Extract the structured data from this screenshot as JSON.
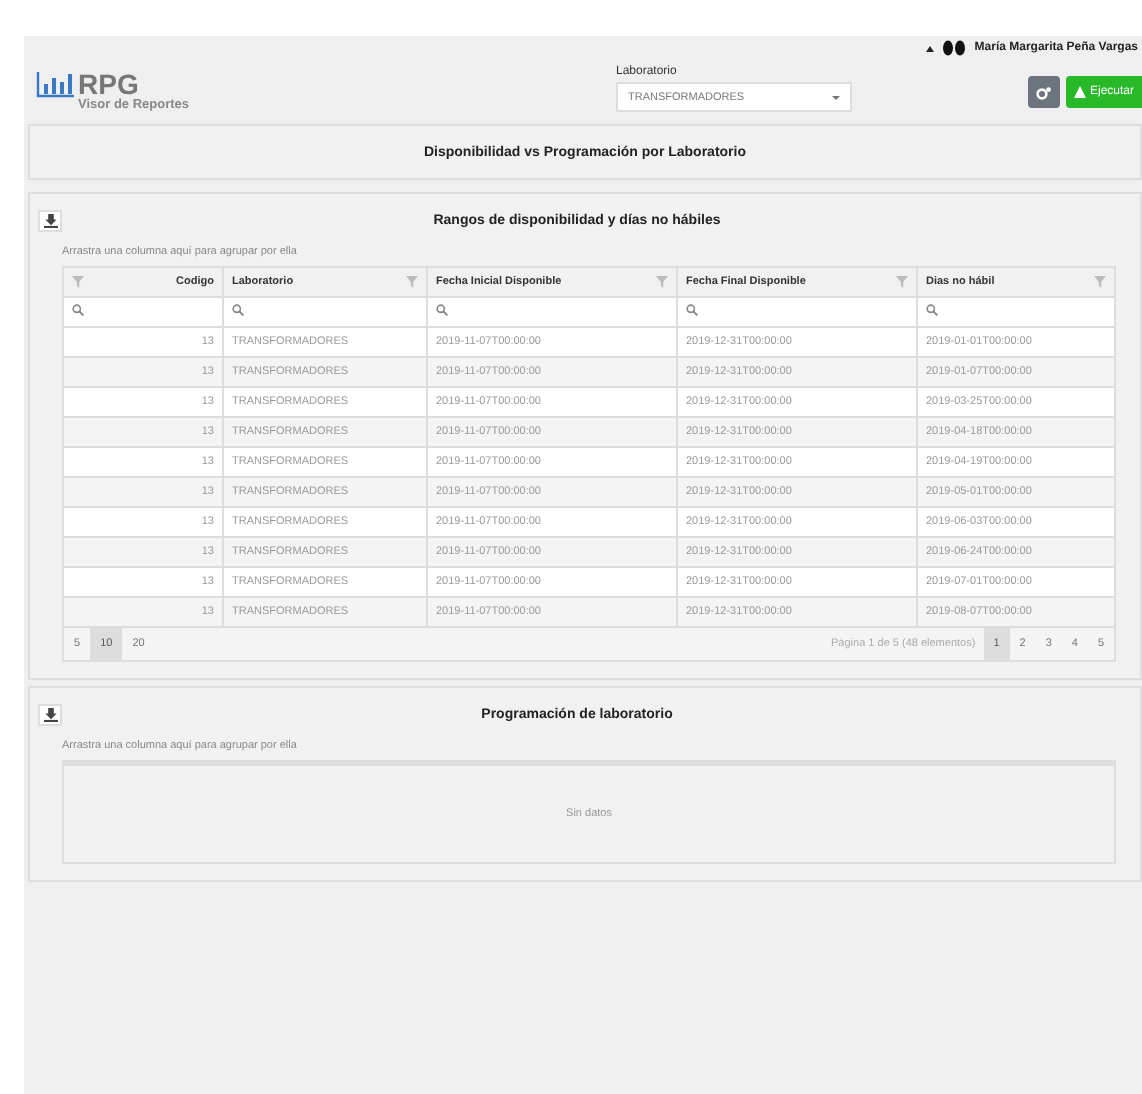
{
  "user": {
    "name": "María Margarita Peña Vargas"
  },
  "logo": {
    "title": "RPG",
    "subtitle": "Visor de Reportes"
  },
  "filter": {
    "label": "Laboratorio",
    "value": "TRANSFORMADORES"
  },
  "toolbar": {
    "run_label": "Ejecutar"
  },
  "report_title": "Disponibilidad vs Programación por Laboratorio",
  "grid1": {
    "title": "Rangos de disponibilidad y días no hábiles",
    "group_hint": "Arrastra una columna aquí para agrupar por ella",
    "columns": [
      "Codigo",
      "Laboratorio",
      "Fecha Inicial Disponible",
      "Fecha Final Disponible",
      "Dias no hábil"
    ],
    "rows": [
      [
        "13",
        "TRANSFORMADORES",
        "2019-11-07T00:00:00",
        "2019-12-31T00:00:00",
        "2019-01-01T00:00:00"
      ],
      [
        "13",
        "TRANSFORMADORES",
        "2019-11-07T00:00:00",
        "2019-12-31T00:00:00",
        "2019-01-07T00:00:00"
      ],
      [
        "13",
        "TRANSFORMADORES",
        "2019-11-07T00:00:00",
        "2019-12-31T00:00:00",
        "2019-03-25T00:00:00"
      ],
      [
        "13",
        "TRANSFORMADORES",
        "2019-11-07T00:00:00",
        "2019-12-31T00:00:00",
        "2019-04-18T00:00:00"
      ],
      [
        "13",
        "TRANSFORMADORES",
        "2019-11-07T00:00:00",
        "2019-12-31T00:00:00",
        "2019-04-19T00:00:00"
      ],
      [
        "13",
        "TRANSFORMADORES",
        "2019-11-07T00:00:00",
        "2019-12-31T00:00:00",
        "2019-05-01T00:00:00"
      ],
      [
        "13",
        "TRANSFORMADORES",
        "2019-11-07T00:00:00",
        "2019-12-31T00:00:00",
        "2019-06-03T00:00:00"
      ],
      [
        "13",
        "TRANSFORMADORES",
        "2019-11-07T00:00:00",
        "2019-12-31T00:00:00",
        "2019-06-24T00:00:00"
      ],
      [
        "13",
        "TRANSFORMADORES",
        "2019-11-07T00:00:00",
        "2019-12-31T00:00:00",
        "2019-07-01T00:00:00"
      ],
      [
        "13",
        "TRANSFORMADORES",
        "2019-11-07T00:00:00",
        "2019-12-31T00:00:00",
        "2019-08-07T00:00:00"
      ]
    ],
    "page_sizes": [
      {
        "label": "5",
        "selected": false
      },
      {
        "label": "10",
        "selected": true
      },
      {
        "label": "20",
        "selected": false
      }
    ],
    "page_info": "Página 1 de 5 (48 elementos)",
    "pages": [
      {
        "label": "1",
        "selected": true
      },
      {
        "label": "2",
        "selected": false
      },
      {
        "label": "3",
        "selected": false
      },
      {
        "label": "4",
        "selected": false
      },
      {
        "label": "5",
        "selected": false
      }
    ]
  },
  "grid2": {
    "title": "Programación de laboratorio",
    "group_hint": "Arrastra una columna aquí para agrupar por ella",
    "empty_text": "Sin datos"
  }
}
